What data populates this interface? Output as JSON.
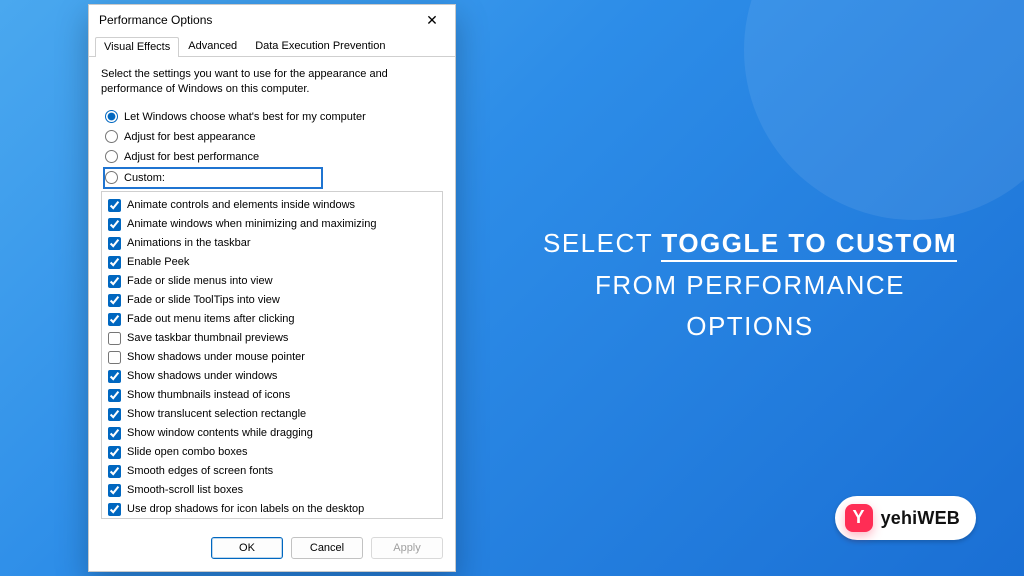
{
  "dialog": {
    "title": "Performance Options",
    "tabs": [
      {
        "label": "Visual Effects",
        "active": true
      },
      {
        "label": "Advanced",
        "active": false
      },
      {
        "label": "Data Execution Prevention",
        "active": false
      }
    ],
    "instruction": "Select the settings you want to use for the appearance and performance of Windows on this computer.",
    "radios": [
      {
        "label": "Let Windows choose what's best for my computer",
        "checked": true,
        "highlight": false
      },
      {
        "label": "Adjust for best appearance",
        "checked": false,
        "highlight": false
      },
      {
        "label": "Adjust for best performance",
        "checked": false,
        "highlight": false
      },
      {
        "label": "Custom:",
        "checked": false,
        "highlight": true
      }
    ],
    "options": [
      {
        "label": "Animate controls and elements inside windows",
        "checked": true
      },
      {
        "label": "Animate windows when minimizing and maximizing",
        "checked": true
      },
      {
        "label": "Animations in the taskbar",
        "checked": true
      },
      {
        "label": "Enable Peek",
        "checked": true
      },
      {
        "label": "Fade or slide menus into view",
        "checked": true
      },
      {
        "label": "Fade or slide ToolTips into view",
        "checked": true
      },
      {
        "label": "Fade out menu items after clicking",
        "checked": true
      },
      {
        "label": "Save taskbar thumbnail previews",
        "checked": false
      },
      {
        "label": "Show shadows under mouse pointer",
        "checked": false
      },
      {
        "label": "Show shadows under windows",
        "checked": true
      },
      {
        "label": "Show thumbnails instead of icons",
        "checked": true
      },
      {
        "label": "Show translucent selection rectangle",
        "checked": true
      },
      {
        "label": "Show window contents while dragging",
        "checked": true
      },
      {
        "label": "Slide open combo boxes",
        "checked": true
      },
      {
        "label": "Smooth edges of screen fonts",
        "checked": true
      },
      {
        "label": "Smooth-scroll list boxes",
        "checked": true
      },
      {
        "label": "Use drop shadows for icon labels on the desktop",
        "checked": true
      }
    ],
    "buttons": {
      "ok": "OK",
      "cancel": "Cancel",
      "apply": "Apply"
    }
  },
  "callout": {
    "pre": "SELECT ",
    "bold": "TOGGLE TO CUSTOM",
    "line2": "FROM PERFORMANCE",
    "line3": "OPTIONS"
  },
  "badge": {
    "logo_letter": "Y",
    "text_a": "yehi",
    "text_b": "WEB"
  }
}
